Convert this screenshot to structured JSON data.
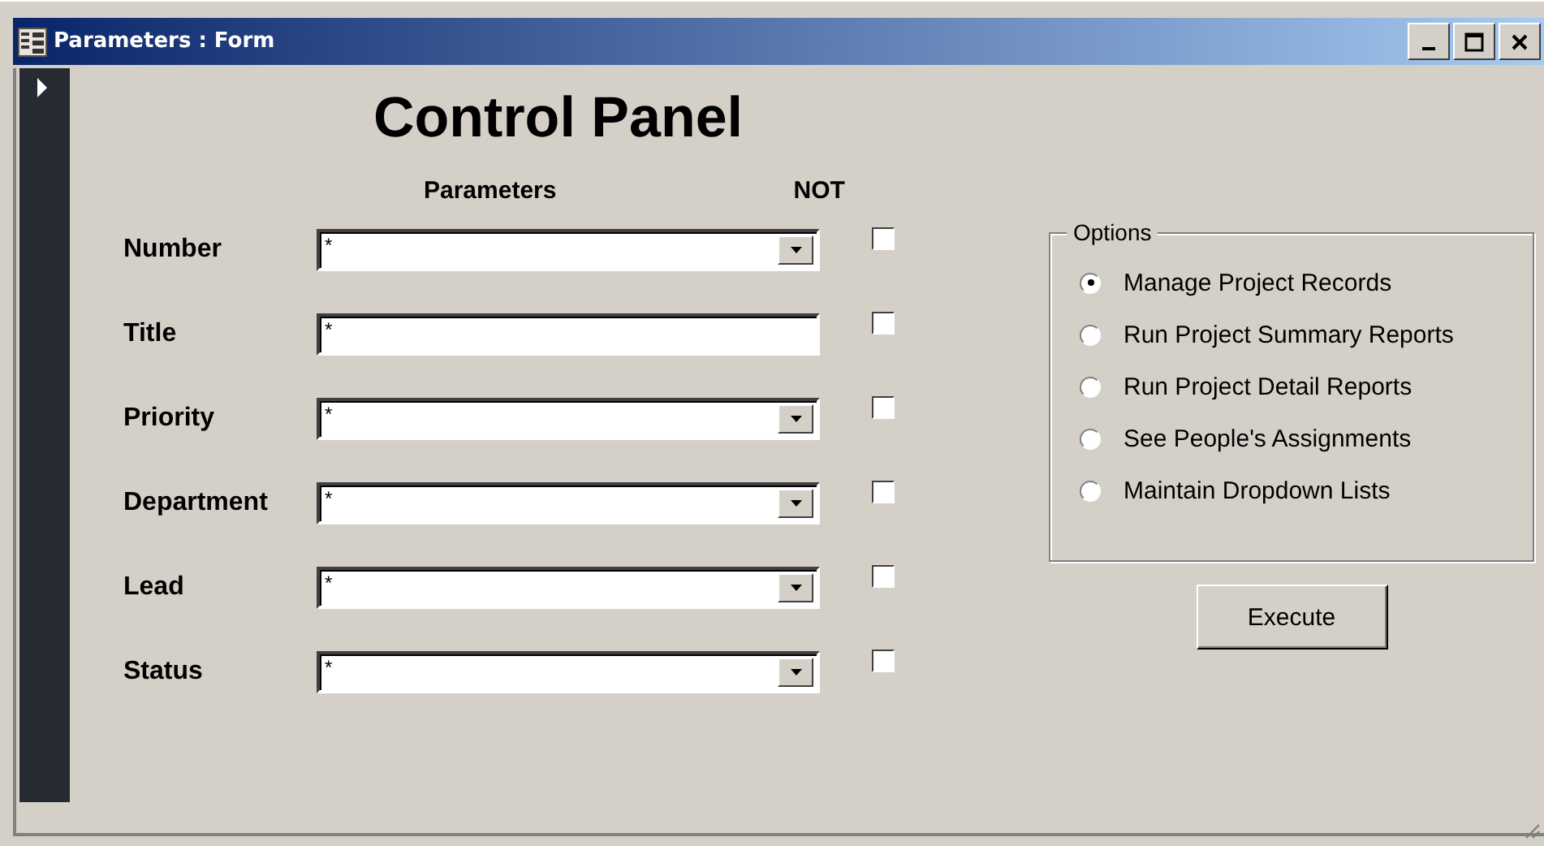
{
  "window": {
    "title": "Parameters : Form"
  },
  "heading": "Control Panel",
  "columns": {
    "parameters": "Parameters",
    "not": "NOT"
  },
  "fields": [
    {
      "label": "Number",
      "kind": "combo",
      "value": "*",
      "not_checked": false
    },
    {
      "label": "Title",
      "kind": "text",
      "value": "*",
      "not_checked": false
    },
    {
      "label": "Priority",
      "kind": "combo",
      "value": "*",
      "not_checked": false
    },
    {
      "label": "Department",
      "kind": "combo",
      "value": "*",
      "not_checked": false
    },
    {
      "label": "Lead",
      "kind": "combo",
      "value": "*",
      "not_checked": false
    },
    {
      "label": "Status",
      "kind": "combo",
      "value": "*",
      "not_checked": false
    }
  ],
  "options": {
    "title": "Options",
    "items": [
      {
        "label": "Manage Project Records",
        "selected": true
      },
      {
        "label": "Run Project Summary Reports",
        "selected": false
      },
      {
        "label": "Run Project Detail Reports",
        "selected": false
      },
      {
        "label": "See People's Assignments",
        "selected": false
      },
      {
        "label": "Maintain Dropdown Lists",
        "selected": false
      }
    ]
  },
  "buttons": [
    "Execute"
  ]
}
